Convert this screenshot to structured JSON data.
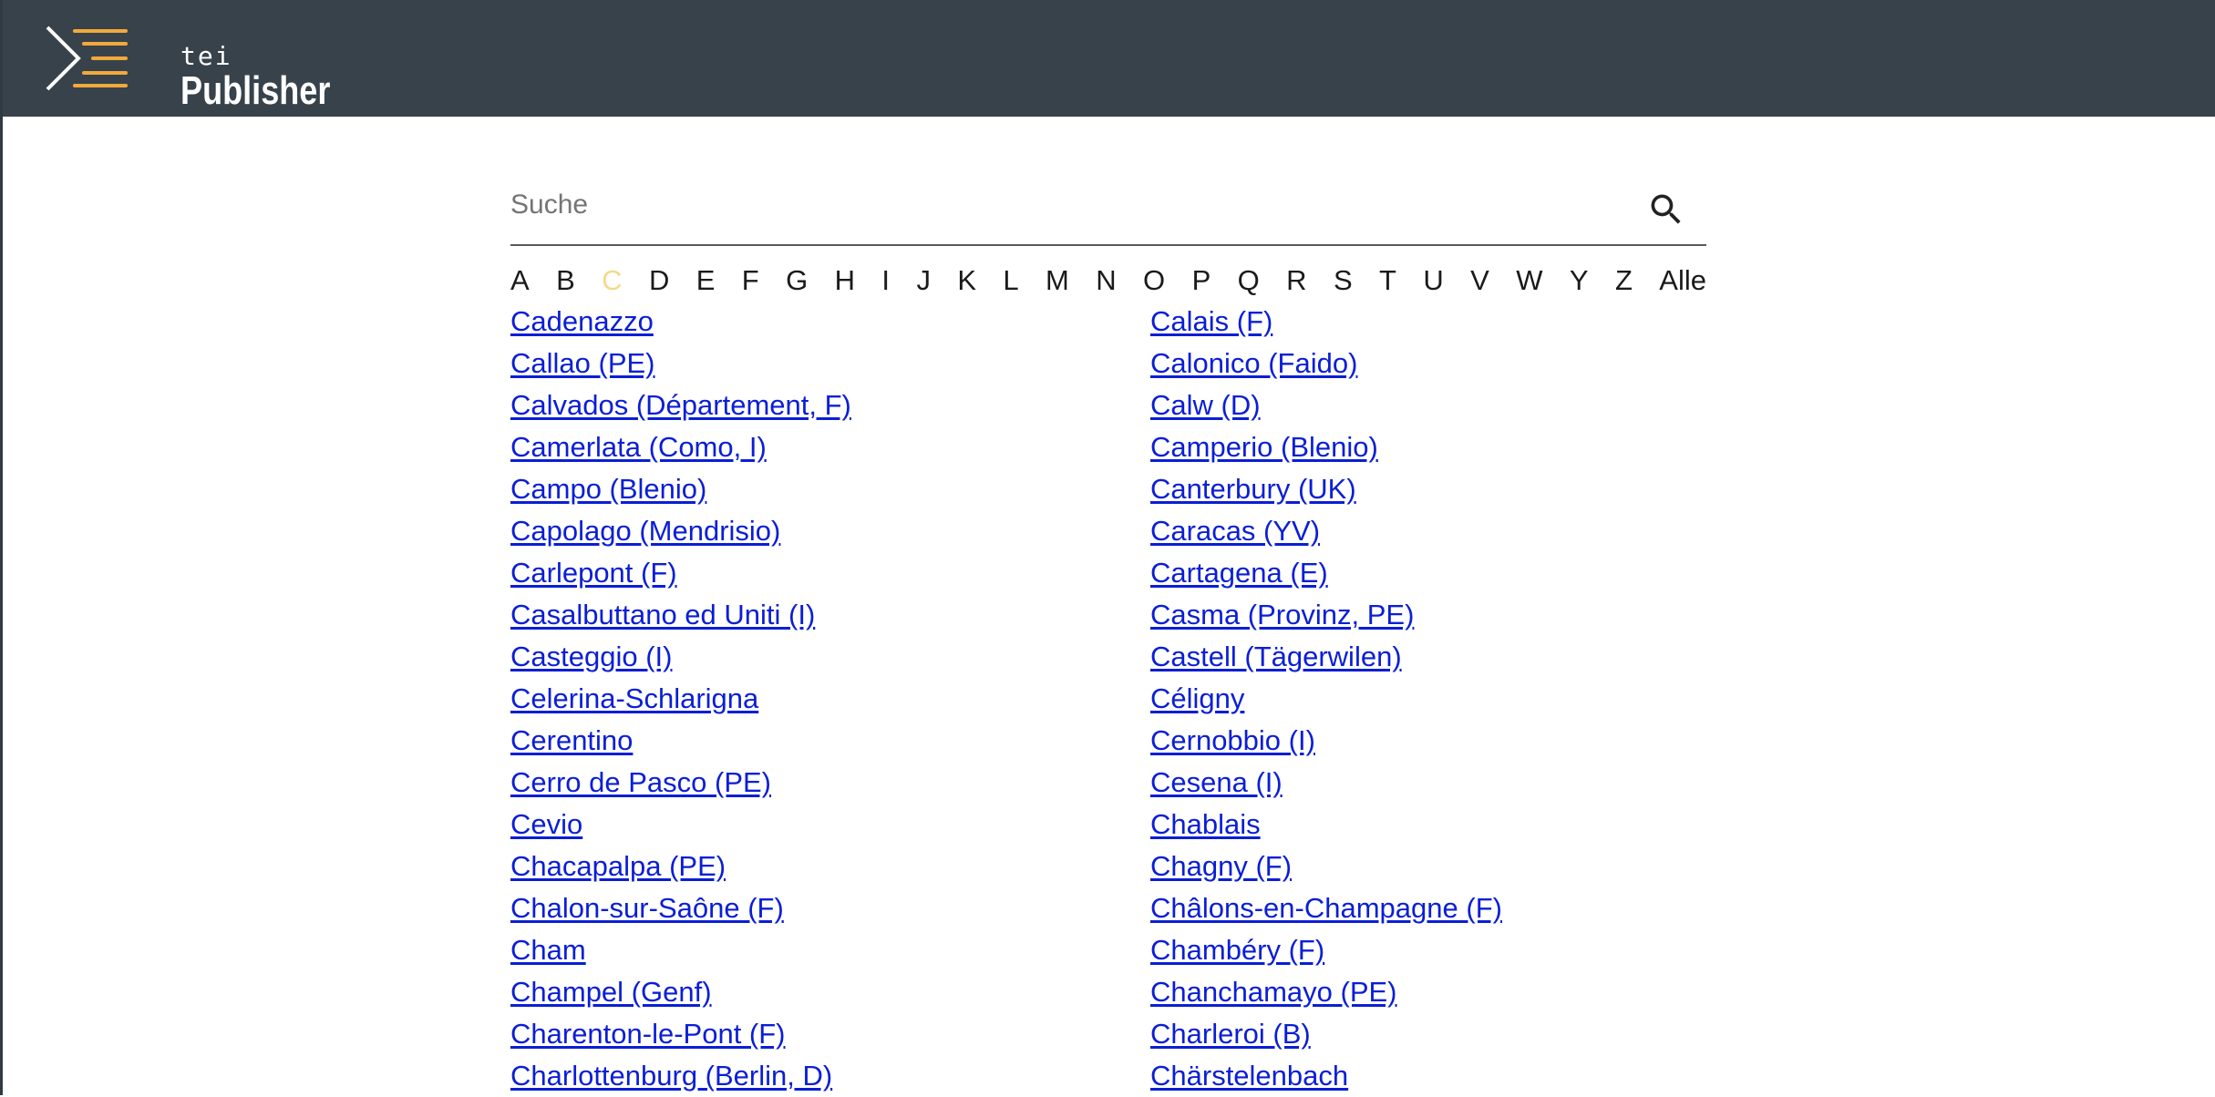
{
  "header": {
    "logo_small": "tei",
    "logo_large": "Publisher"
  },
  "search": {
    "placeholder": "Suche",
    "value": ""
  },
  "alphabet": {
    "letters": [
      "A",
      "B",
      "C",
      "D",
      "E",
      "F",
      "G",
      "H",
      "I",
      "J",
      "K",
      "L",
      "M",
      "N",
      "O",
      "P",
      "Q",
      "R",
      "S",
      "T",
      "U",
      "V",
      "W",
      "Y",
      "Z",
      "Alle"
    ],
    "active": "C"
  },
  "places": [
    "Cadenazzo",
    "Calais (F)",
    "Callao (PE)",
    "Calonico (Faido)",
    "Calvados (Département, F)",
    "Calw (D)",
    "Camerlata (Como, I)",
    "Camperio (Blenio)",
    "Campo (Blenio)",
    "Canterbury (UK)",
    "Capolago (Mendrisio)",
    "Caracas (YV)",
    "Carlepont (F)",
    "Cartagena (E)",
    "Casalbuttano ed Uniti (I)",
    "Casma (Provinz, PE)",
    "Casteggio (I)",
    "Castell (Tägerwilen)",
    "Celerina-Schlarigna",
    "Céligny",
    "Cerentino",
    "Cernobbio (I)",
    "Cerro de Pasco (PE)",
    "Cesena (I)",
    "Cevio",
    "Chablais",
    "Chacapalpa (PE)",
    "Chagny (F)",
    "Chalon-sur-Saône (F)",
    "Châlons-en-Champagne (F)",
    "Cham",
    "Chambéry (F)",
    "Champel (Genf)",
    "Chanchamayo (PE)",
    "Charenton-le-Pont (F)",
    "Charleroi (B)",
    "Charlottenburg (Berlin, D)",
    "Chärstelenbach"
  ],
  "colors": {
    "header_bg": "#37424b",
    "link": "#0a1ed6",
    "active_letter": "#f4d98b",
    "logo_accent": "#f2a93b"
  }
}
